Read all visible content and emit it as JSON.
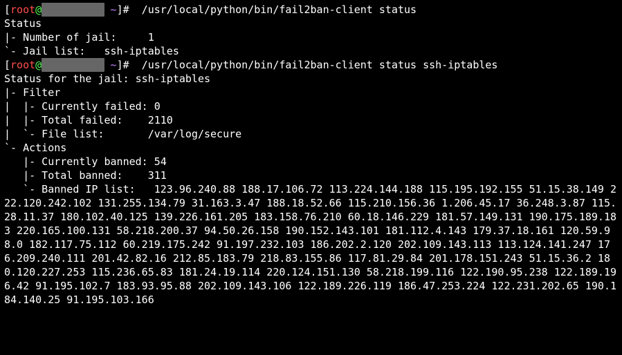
{
  "prompt1": {
    "user": "root",
    "at": "@",
    "host_masked": "          ",
    "cwd": "~",
    "separator": "]#",
    "command": " /usr/local/python/bin/fail2ban-client status"
  },
  "status1": {
    "line_header": "Status",
    "num_jail_label": "|- Number of jail:",
    "num_jail_value": "     1",
    "jail_list_label": "`- Jail list:",
    "jail_list_value": "   ssh-iptables"
  },
  "prompt2": {
    "user": "root",
    "at": "@",
    "host_masked": "          ",
    "cwd": "~",
    "separator": "]#",
    "command": " /usr/local/python/bin/fail2ban-client status ssh-iptables"
  },
  "status2": {
    "header": "Status for the jail: ssh-iptables",
    "filter_label": "|- Filter",
    "cur_failed_label": "|  |- Currently failed:",
    "cur_failed_value": " 0",
    "tot_failed_label": "|  |- Total failed:",
    "tot_failed_value": "    2110",
    "file_list_label": "|  `- File list:",
    "file_list_value": "       /var/log/secure",
    "actions_label": "`- Actions",
    "cur_banned_label": "   |- Currently banned:",
    "cur_banned_value": " 54",
    "tot_banned_label": "   |- Total banned:",
    "tot_banned_value": "    311",
    "banned_list_label": "   `- Banned IP list:",
    "banned_list_value": "   123.96.240.88 188.17.106.72 113.224.144.188 115.195.192.155 51.15.38.149 222.120.242.102 131.255.134.79 31.163.3.47 188.18.52.66 115.210.156.36 1.206.45.17 36.248.3.87 115.28.11.37 180.102.40.125 139.226.161.205 183.158.76.210 60.18.146.229 181.57.149.131 190.175.189.183 220.165.100.131 58.218.200.37 94.50.26.158 190.152.143.101 181.112.4.143 179.37.18.161 120.59.98.0 182.117.75.112 60.219.175.242 91.197.232.103 186.202.2.120 202.109.143.113 113.124.141.247 176.209.240.111 201.42.82.16 212.85.183.79 218.83.155.86 117.81.29.84 201.178.151.243 51.15.36.2 180.120.227.253 115.236.65.83 181.24.19.114 220.124.151.130 58.218.199.116 122.190.95.238 122.189.196.42 91.195.102.7 183.93.95.88 202.109.143.106 122.189.226.119 186.47.253.224 122.231.202.65 190.184.140.25 91.195.103.166"
  }
}
